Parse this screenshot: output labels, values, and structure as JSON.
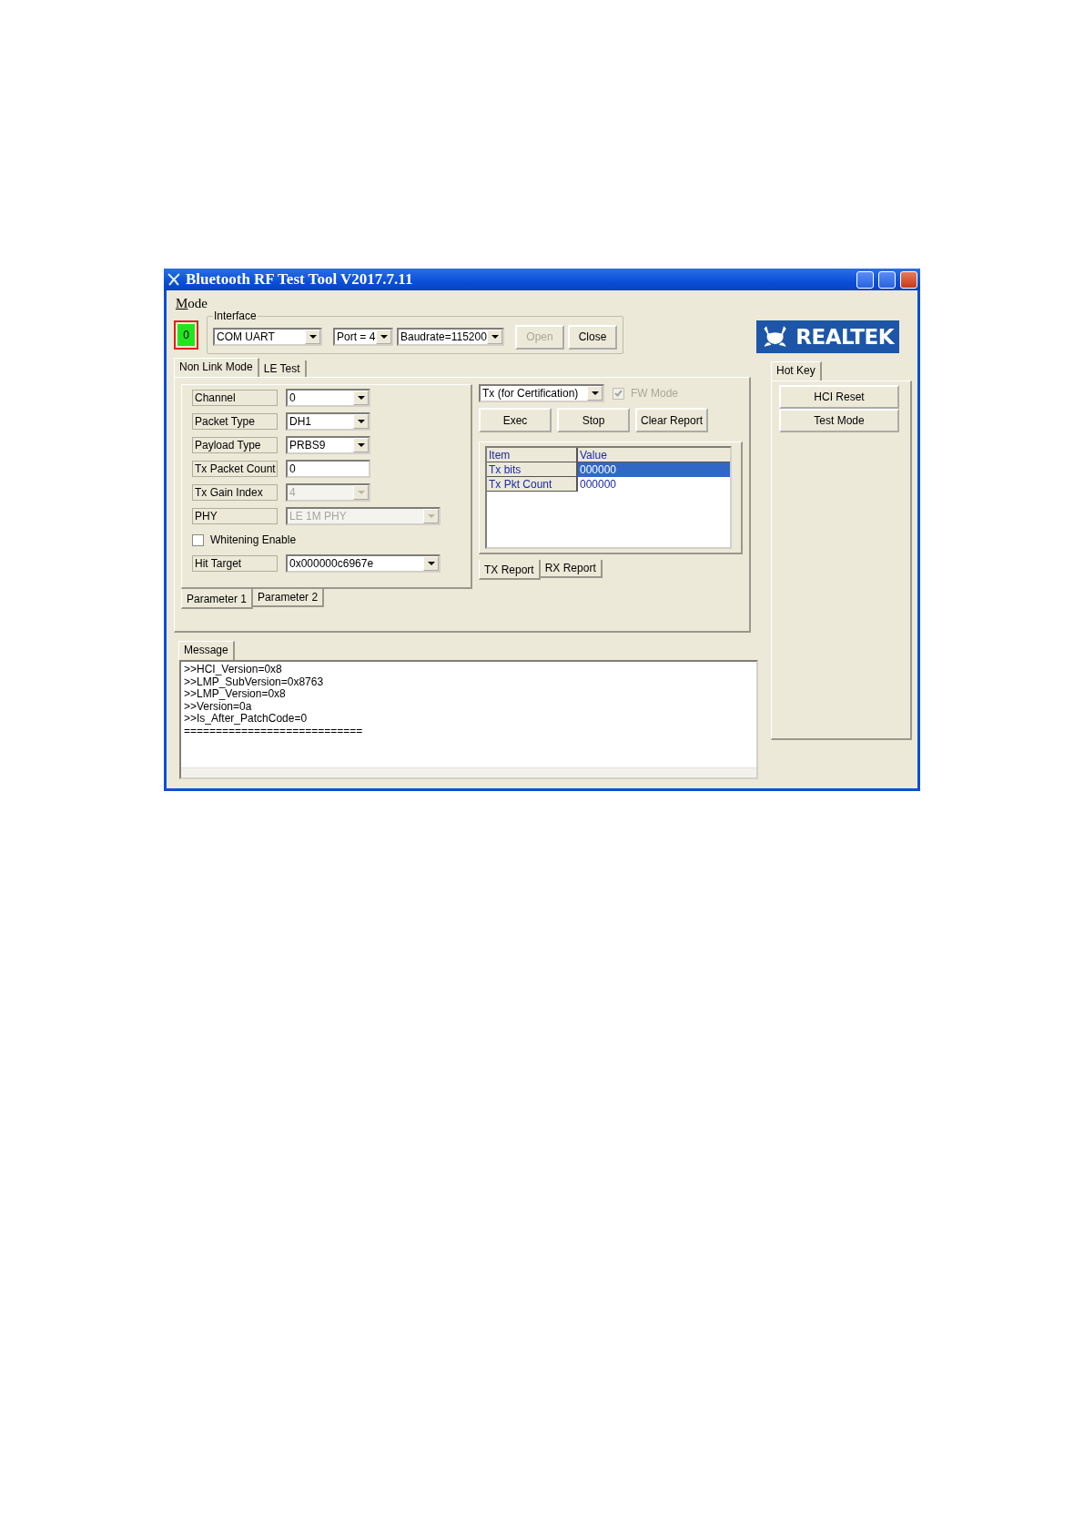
{
  "window": {
    "title": "Bluetooth RF Test Tool V2017.7.11"
  },
  "menu": [
    {
      "label": "Mode"
    }
  ],
  "status_indicator": {
    "text": "0"
  },
  "interface": {
    "label": "Interface",
    "type": "COM UART",
    "port": "Port = 4",
    "baudrate": "Baudrate=115200",
    "buttons": [
      {
        "label": "Open",
        "disabled": true
      },
      {
        "label": "Close",
        "disabled": false
      }
    ]
  },
  "logo": {
    "text": "REALTEK"
  },
  "mode_tabs": [
    {
      "label": "Non Link Mode",
      "selected": true
    },
    {
      "label": "LE Test",
      "selected": false
    }
  ],
  "parameters": [
    {
      "label": "Channel",
      "kind": "combo",
      "value": "0",
      "disabled": false
    },
    {
      "label": "Packet Type",
      "kind": "combo",
      "value": "DH1",
      "disabled": false
    },
    {
      "label": "Payload Type",
      "kind": "combo",
      "value": "PRBS9",
      "disabled": false
    },
    {
      "label": "Tx Packet Count",
      "kind": "text",
      "value": "0",
      "disabled": false
    },
    {
      "label": "Tx Gain Index",
      "kind": "combo",
      "value": "4",
      "disabled": true
    },
    {
      "label": "PHY",
      "kind": "wide-combo",
      "value": "LE 1M PHY",
      "disabled": true
    },
    {
      "label": "Whitening Enable",
      "kind": "checkbox",
      "checked": false
    },
    {
      "label": "Hit Target",
      "kind": "wide-combo",
      "value": "0x000000c6967e",
      "disabled": false
    }
  ],
  "parameter_tabs": [
    {
      "label": "Parameter 1",
      "selected": true
    },
    {
      "label": "Parameter 2",
      "selected": false
    }
  ],
  "test_mode": {
    "value": "Tx (for Certification)"
  },
  "fw_mode": {
    "label": "FW Mode",
    "checked": true,
    "disabled": true
  },
  "actions": [
    {
      "label": "Exec"
    },
    {
      "label": "Stop"
    },
    {
      "label": "Clear Report"
    }
  ],
  "report": {
    "columns": [
      "Item",
      "Value"
    ],
    "rows": [
      {
        "item": "Tx bits",
        "value": "000000",
        "selected": true
      },
      {
        "item": "Tx Pkt Count",
        "value": "000000",
        "selected": false
      }
    ]
  },
  "report_tabs": [
    {
      "label": "TX Report",
      "selected": true
    },
    {
      "label": "RX Report",
      "selected": false
    }
  ],
  "hot_key": {
    "tab": "Hot Key",
    "buttons": [
      "HCI Reset",
      "Test Mode"
    ]
  },
  "message": {
    "tab": "Message",
    "lines": [
      ">>HCI_Version=0x8",
      ">>LMP_SubVersion=0x8763",
      ">>LMP_Version=0x8",
      ">>Version=0a",
      ">>Is_After_PatchCode=0",
      "============================"
    ]
  }
}
